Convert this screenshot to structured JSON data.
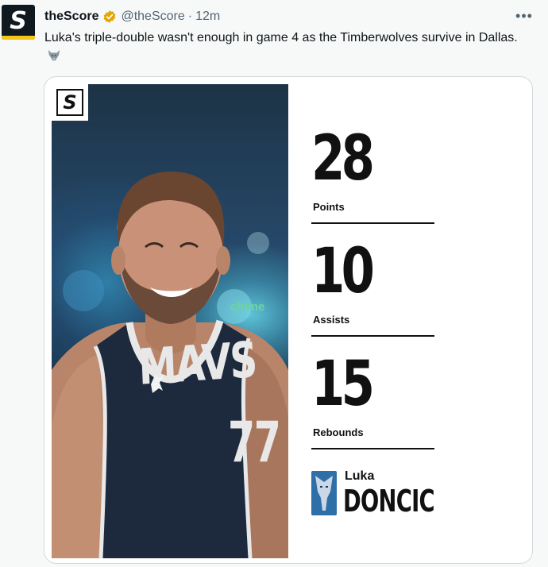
{
  "tweet": {
    "author_name": "theScore",
    "handle": "@theScore",
    "separator": "·",
    "time": "12m",
    "text": "Luka's triple-double wasn't enough in game 4 as the Timberwolves survive in Dallas.",
    "emoji_icon": "wolf-icon",
    "avatar_letter": "S"
  },
  "card": {
    "brand_letter": "S",
    "stats": [
      {
        "value": "28",
        "label": "Points"
      },
      {
        "value": "10",
        "label": "Assists"
      },
      {
        "value": "15",
        "label": "Rebounds"
      }
    ],
    "player": {
      "first_name": "Luka",
      "last_name": "DONCIC"
    },
    "jersey": {
      "team_text": "MAVS",
      "number": "77",
      "sponsor": "chime"
    }
  },
  "colors": {
    "accent": "#f5c518",
    "verified": "#f4b400",
    "mavs_blue": "#3a86c8",
    "muted": "#536471"
  }
}
